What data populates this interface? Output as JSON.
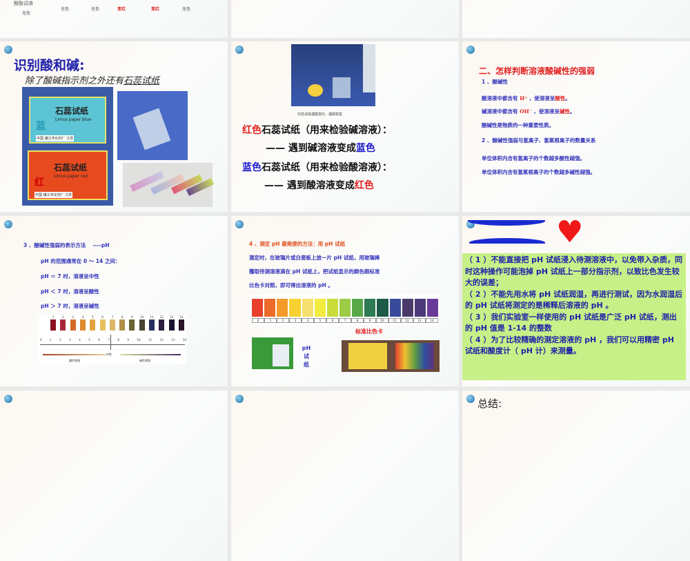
{
  "slide_top": {
    "label_left": "酚酞试液",
    "cells": [
      "无色",
      "无色",
      "变红",
      "变红",
      "无色"
    ],
    "under_label": "无色"
  },
  "slide1": {
    "title": "识别酸和碱:",
    "bullet": "除了酸碱指示剂之外还有",
    "bullet_underlined": "石蕊试纸",
    "box_blue": {
      "name": "石蕊试纸",
      "en": "Limus paper blue",
      "char": "蓝",
      "maker": "中国 镇江市化剂厂 江苏"
    },
    "box_red": {
      "name": "石蕊试纸",
      "en": "Limus paper red",
      "char": "红",
      "maker": "中国 镇江市化剂厂 江苏"
    }
  },
  "slide2": {
    "caption": "石蕊试纸遇酸变红，遇碱变蓝",
    "line1_color": "红色",
    "line1_rest": "石蕊试纸（用来检验碱溶液）：",
    "line2_prefix": "—— 遇到碱溶液变成",
    "line2_color": "蓝色",
    "line3_color": "蓝色",
    "line3_rest": "石蕊试纸（用来检验酸溶液）：",
    "line4_prefix": "—— 遇到酸溶液变成",
    "line4_color": "红色"
  },
  "slide3": {
    "title": "二、怎样判断溶液酸碱性的强弱",
    "s1": "1 、酸碱性",
    "l1a": "酸溶液中都含有 ",
    "l1ion": "H⁺",
    "l1b": " ，使溶液呈",
    "l1c": "酸性",
    "l1d": "。",
    "l2a": "碱溶液中都含有 ",
    "l2ion": "OH⁻",
    "l2b": " ，使溶液呈",
    "l2c": "碱性",
    "l2d": "。",
    "l3": "酸碱性是物质的一种重要性质。",
    "s2": "2 、酸碱性强弱与氢离子、氢氧根离子的数量关系",
    "l4": "单位体积内含有氢离子的个数越多酸性越强。",
    "l5": "单位体积内含有氢氧根离子的个数越多碱性越强。"
  },
  "slide4": {
    "title": "3 、酸碱性强弱的表示方法　 ----pH",
    "range": "pH 的范围通常在 0 ～ 14 之间：",
    "eq": "pH ＝ 7 时，溶液呈中性",
    "lt": "pH ＜ 7 时，溶液呈酸性",
    "gt": "pH ＞ 7 时，溶液呈碱性",
    "scale_top": [
      "1",
      "2",
      "3",
      "4",
      "5",
      "6",
      "7",
      "8",
      "9",
      "10",
      "11",
      "12",
      "13",
      "14"
    ],
    "scale_bottom": [
      "0",
      "1",
      "2",
      "3",
      "4",
      "5",
      "6",
      "7",
      "8",
      "9",
      "10",
      "11",
      "12",
      "13",
      "14"
    ],
    "swatch_colors": [
      "#8a1020",
      "#a8283a",
      "#d46a28",
      "#de8a30",
      "#e2a440",
      "#e8c060",
      "#dcb868",
      "#b09048",
      "#6a6430",
      "#4a4430",
      "#283060",
      "#2a1e40",
      "#1a1430",
      "#2a1428"
    ],
    "neutral": "中性",
    "acid_label": "酸性增强",
    "base_label": "碱性增强"
  },
  "slide5": {
    "title": "4 、测定 pH 最简便的方法：用 pH 试纸",
    "p1": "测定时，在玻璃片或白瓷板上放一片 pH 试纸，用玻璃棒",
    "p2": "蘸取待测溶液滴在 pH 试纸上，把试纸显示的颜色跟标准",
    "p3": "比色卡对照，即可得出溶液的 pH 。",
    "card_numbers": [
      "0",
      "1",
      "2",
      "3",
      "4",
      "5",
      "6",
      "7",
      "8",
      "9",
      "10",
      "11",
      "12",
      "13",
      "14"
    ],
    "card_colors": [
      "#e8402a",
      "#ee6a2a",
      "#f49a2a",
      "#f8d030",
      "#f6e070",
      "#f2ec40",
      "#c8dc3a",
      "#9ccc48",
      "#58a848",
      "#2e7a52",
      "#1e5a48",
      "#3a4a9a",
      "#4a3a6a",
      "#4a3a7a",
      "#6a3a9a"
    ],
    "card_label": "标准比色卡",
    "strip_label": "pH 试纸"
  },
  "slide6": {
    "points": [
      "（ 1 ）不能直接把 pH 试纸浸入待测溶液中，以免带入杂质，同时这种操作可能泡掉 pH 试纸上一部分指示剂，以致比色发生较大的误差；",
      "（ 2 ）不能先用水将 pH 试纸润湿，再进行测试，因为水润湿后的 pH 试纸将测定的是稀释后溶液的 pH 。",
      "（ 3 ）我们实验室一样使用的 pH 试纸是广泛 pH 试纸，测出的 pH 值是 1-14 的整数",
      "（ 4 ）为了比较精确的测定溶液的 pH ，我们可以用精密 pH 试纸和酸度计（ pH 计）来测量。"
    ]
  },
  "slide9": {
    "title": "总结:"
  }
}
